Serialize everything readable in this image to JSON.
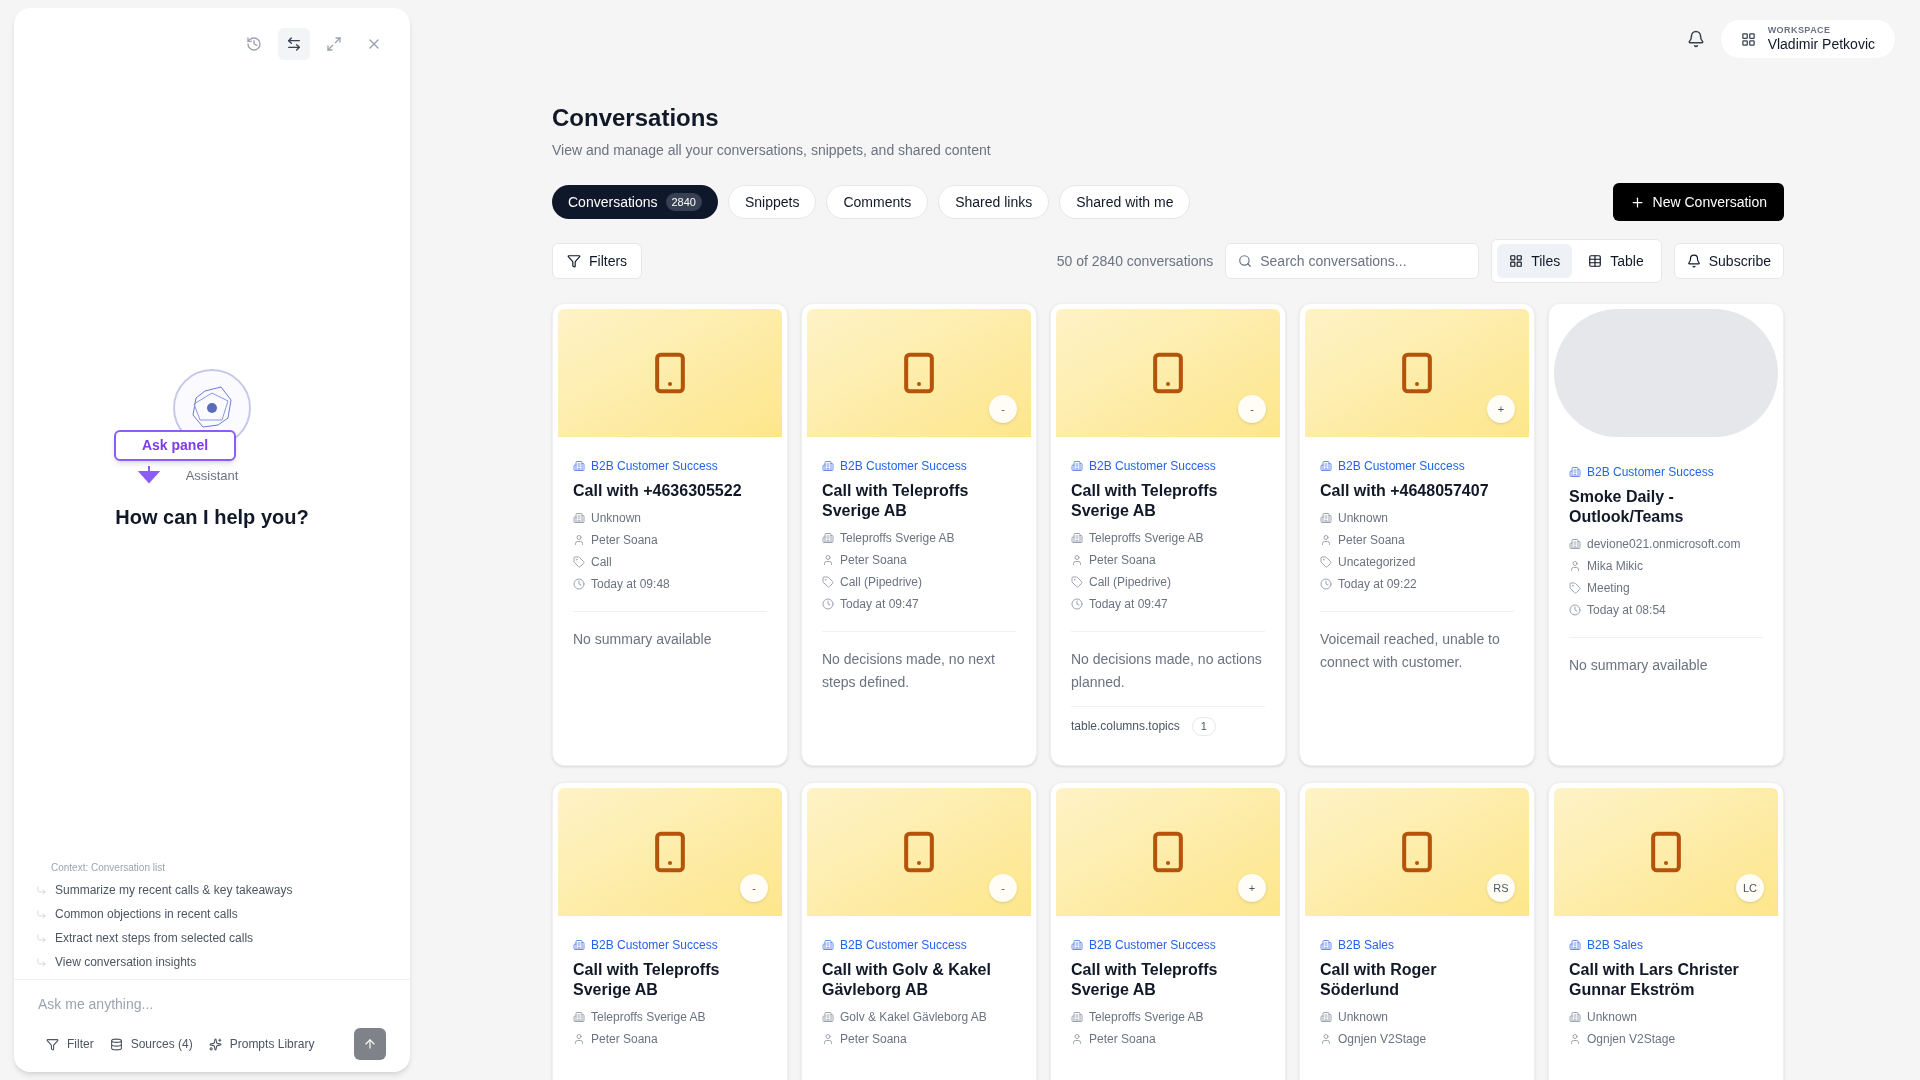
{
  "assistant": {
    "toolbar": [
      {
        "kind": "history",
        "selected": false
      },
      {
        "kind": "swap",
        "selected": true
      },
      {
        "kind": "expand",
        "selected": false
      },
      {
        "kind": "close",
        "selected": false
      }
    ],
    "callout": "Ask panel",
    "label": "Assistant",
    "heading": "How can I help you?",
    "context": "Context: Conversation list",
    "suggestions": [
      "Summarize my recent calls & key takeaways",
      "Common objections in recent calls",
      "Extract next steps from selected calls",
      "View conversation insights"
    ],
    "input": {
      "placeholder": "Ask me anything..."
    },
    "actions": [
      {
        "kind": "filter",
        "label": "Filter"
      },
      {
        "kind": "sources",
        "label": "Sources (4)"
      },
      {
        "kind": "prompts",
        "label": "Prompts Library"
      }
    ]
  },
  "header": {
    "workspace_label": "WORKSPACE",
    "workspace_name": "Vladimir Petkovic"
  },
  "page": {
    "title": "Conversations",
    "subtitle": "View and manage all your conversations, snippets, and shared content"
  },
  "tabs": [
    {
      "label": "Conversations",
      "count": "2840",
      "selected": true
    },
    {
      "label": "Snippets",
      "selected": false
    },
    {
      "label": "Comments",
      "selected": false
    },
    {
      "label": "Shared links",
      "selected": false
    },
    {
      "label": "Shared with me",
      "selected": false
    }
  ],
  "new_button": "New Conversation",
  "toolbar": {
    "filters": "Filters",
    "result_count": "50 of 2840 conversations",
    "search": {
      "placeholder": "Search conversations..."
    },
    "views": [
      {
        "kind": "tiles",
        "label": "Tiles",
        "selected": true
      },
      {
        "kind": "table",
        "label": "Table",
        "selected": false
      }
    ],
    "subscribe": "Subscribe"
  },
  "cards": [
    {
      "thumbnail": {
        "kind": "phone"
      },
      "group": "B2B Customer Success",
      "title": "Call with +4636305522",
      "details": [
        {
          "kind": "company",
          "text": "Unknown"
        },
        {
          "kind": "person",
          "text": "Peter Soana"
        },
        {
          "kind": "tag",
          "text": "Call"
        },
        {
          "kind": "time",
          "text": "Today at 09:48"
        }
      ],
      "summary": "No summary available"
    },
    {
      "thumbnail": {
        "kind": "phone"
      },
      "badge": "-",
      "group": "B2B Customer Success",
      "title": "Call with Teleproffs Sverige AB",
      "details": [
        {
          "kind": "company",
          "text": "Teleproffs Sverige AB"
        },
        {
          "kind": "person",
          "text": "Peter Soana"
        },
        {
          "kind": "tag",
          "text": "Call (Pipedrive)"
        },
        {
          "kind": "time",
          "text": "Today at 09:47"
        }
      ],
      "summary": "No decisions made, no next steps defined."
    },
    {
      "thumbnail": {
        "kind": "phone"
      },
      "badge": "-",
      "group": "B2B Customer Success",
      "title": "Call with Teleproffs Sverige AB",
      "details": [
        {
          "kind": "company",
          "text": "Teleproffs Sverige AB"
        },
        {
          "kind": "person",
          "text": "Peter Soana"
        },
        {
          "kind": "tag",
          "text": "Call (Pipedrive)"
        },
        {
          "kind": "time",
          "text": "Today at 09:47"
        }
      ],
      "summary": "No decisions made, no actions planned.",
      "topics": {
        "label": "table.columns.topics",
        "count": "1"
      }
    },
    {
      "thumbnail": {
        "kind": "phone"
      },
      "badge": "+",
      "group": "B2B Customer Success",
      "title": "Call with +4648057407",
      "details": [
        {
          "kind": "company",
          "text": "Unknown"
        },
        {
          "kind": "person",
          "text": "Peter Soana"
        },
        {
          "kind": "tag",
          "text": "Uncategorized"
        },
        {
          "kind": "time",
          "text": "Today at 09:22"
        }
      ],
      "summary": "Voicemail reached, unable to connect with customer."
    },
    {
      "thumbnail": {
        "kind": "placeholder"
      },
      "group": "B2B Customer Success",
      "title": "Smoke Daily - Outlook/Teams",
      "details": [
        {
          "kind": "company",
          "text": "devione021.onmicrosoft.com"
        },
        {
          "kind": "person",
          "text": "Mika Mikic"
        },
        {
          "kind": "tag",
          "text": "Meeting"
        },
        {
          "kind": "time",
          "text": "Today at 08:54"
        }
      ],
      "summary": "No summary available"
    },
    {
      "thumbnail": {
        "kind": "phone"
      },
      "badge": "-",
      "group": "B2B Customer Success",
      "title": "Call with Teleproffs Sverige AB",
      "details": [
        {
          "kind": "company",
          "text": "Teleproffs Sverige AB"
        },
        {
          "kind": "person",
          "text": "Peter Soana"
        }
      ]
    },
    {
      "thumbnail": {
        "kind": "phone"
      },
      "badge": "-",
      "group": "B2B Customer Success",
      "title": "Call with Golv & Kakel Gävleborg AB",
      "details": [
        {
          "kind": "company",
          "text": "Golv & Kakel Gävleborg AB"
        },
        {
          "kind": "person",
          "text": "Peter Soana"
        }
      ]
    },
    {
      "thumbnail": {
        "kind": "phone"
      },
      "badge": "+",
      "group": "B2B Customer Success",
      "title": "Call with Teleproffs Sverige AB",
      "details": [
        {
          "kind": "company",
          "text": "Teleproffs Sverige AB"
        },
        {
          "kind": "person",
          "text": "Peter Soana"
        }
      ]
    },
    {
      "thumbnail": {
        "kind": "phone"
      },
      "badge": "RS",
      "group": "B2B Sales",
      "title": "Call with Roger Söderlund",
      "details": [
        {
          "kind": "company",
          "text": "Unknown"
        },
        {
          "kind": "person",
          "text": "Ognjen V2Stage"
        }
      ]
    },
    {
      "thumbnail": {
        "kind": "phone"
      },
      "badge": "LC",
      "group": "B2B Sales",
      "title": "Call with Lars Christer Gunnar Ekström",
      "details": [
        {
          "kind": "company",
          "text": "Unknown"
        },
        {
          "kind": "person",
          "text": "Ognjen V2Stage"
        }
      ]
    }
  ]
}
